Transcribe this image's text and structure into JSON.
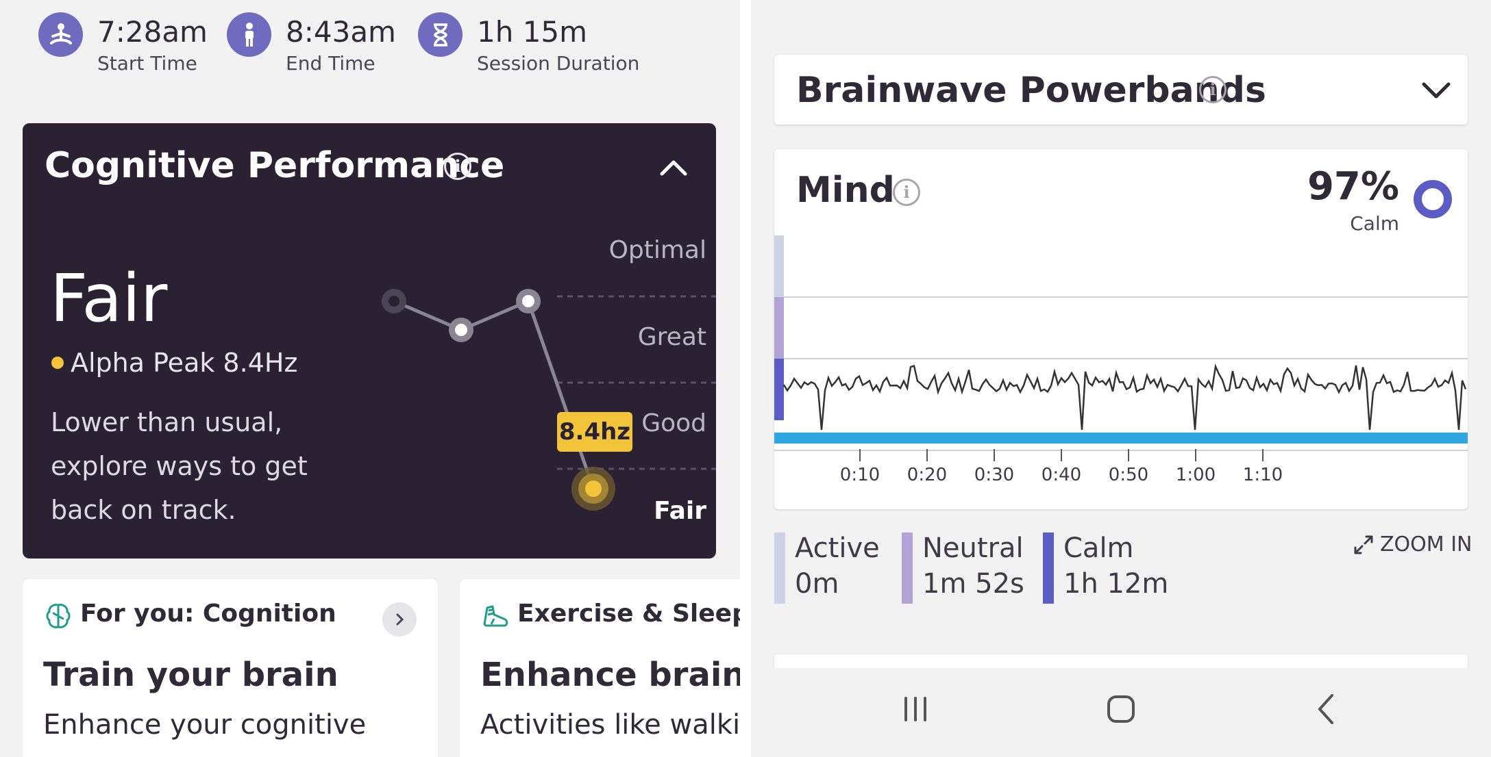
{
  "session": {
    "start_value": "7:28am",
    "start_label": "Start Time",
    "start_icon": "meditation-icon",
    "end_value": "8:43am",
    "end_label": "End Time",
    "end_icon": "standing-person-icon",
    "duration_value": "1h 15m",
    "duration_label": "Session Duration",
    "duration_icon": "hourglass-icon"
  },
  "cognitive": {
    "title": "Cognitive Performance",
    "rating": "Fair",
    "alpha_peak": "Alpha Peak 8.4Hz",
    "description": "Lower than usual, explore ways to get back on track.",
    "levels": [
      "Optimal",
      "Great",
      "Good",
      "Fair"
    ],
    "badge": "8.4hz",
    "trend_levels": [
      "Great",
      "Great",
      "Great",
      "Fair"
    ],
    "accent_color": "#f2c43a",
    "background_color": "#2a2232"
  },
  "cards": {
    "foryou": {
      "header": "For you: Cognition",
      "title": "Train your brain",
      "subtitle": "Enhance your cognitive",
      "icon": "brain-icon"
    },
    "exercise": {
      "header": "Exercise & Sleep",
      "title": "Enhance brain b",
      "subtitle": "Activities like walkir",
      "icon": "running-shoe-icon"
    }
  },
  "powerbands": {
    "title": "Brainwave Powerbands"
  },
  "mind": {
    "title": "Mind",
    "percent": "97%",
    "percent_label": "Calm",
    "zoom_label": "ZOOM IN"
  },
  "legend": [
    {
      "name": "Active",
      "value": "0m",
      "color": "#cdd2e6"
    },
    {
      "name": "Neutral",
      "value": "1m 52s",
      "color": "#b2a2d6"
    },
    {
      "name": "Calm",
      "value": "1h 12m",
      "color": "#5b5cc4"
    }
  ],
  "chart_data": {
    "type": "line",
    "x_ticks": [
      "0:10",
      "0:20",
      "0:30",
      "0:40",
      "0:50",
      "1:00",
      "1:10"
    ],
    "bands": [
      "Active",
      "Neutral",
      "Calm"
    ],
    "series": [
      {
        "name": "Mind",
        "color": "#333333"
      },
      {
        "name": "Calm",
        "color": "#3aa8e0"
      }
    ],
    "ylim": [
      0,
      3
    ],
    "grid": true
  },
  "navbar": {
    "icons": [
      "recent-apps-icon",
      "home-icon",
      "back-icon"
    ]
  }
}
